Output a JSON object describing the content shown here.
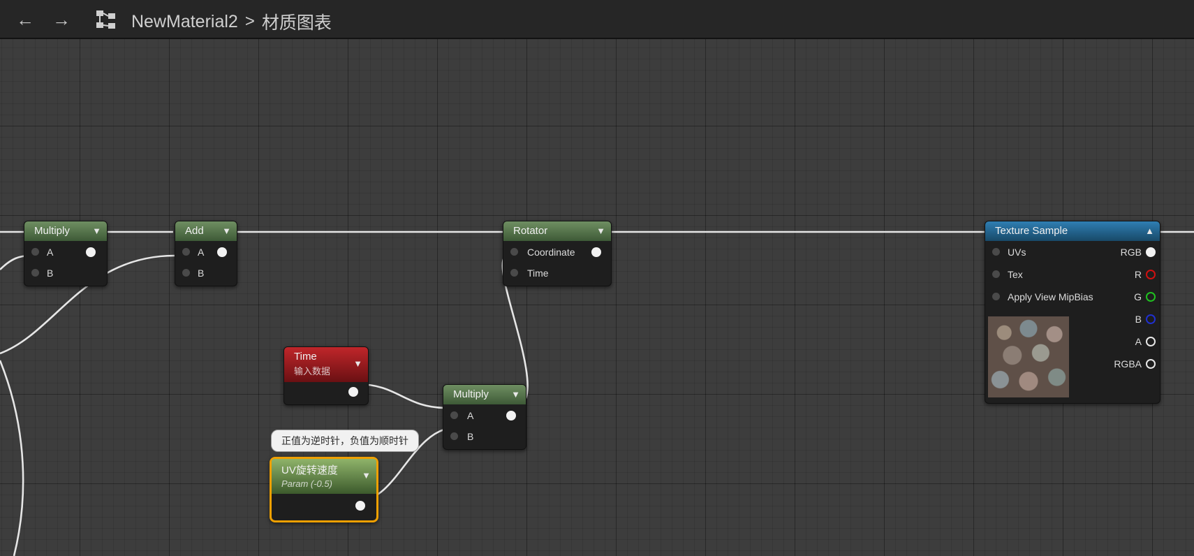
{
  "toolbar": {
    "back_icon": "arrow-left-icon",
    "forward_icon": "arrow-right-icon",
    "graph_icon": "material-graph-icon",
    "breadcrumb": {
      "asset": "NewMaterial2",
      "separator": ">",
      "page": "材质图表"
    }
  },
  "nodes": {
    "multiply1": {
      "title": "Multiply",
      "pins": {
        "a": "A",
        "b": "B"
      }
    },
    "add": {
      "title": "Add",
      "pins": {
        "a": "A",
        "b": "B"
      }
    },
    "rotator": {
      "title": "Rotator",
      "pins": {
        "coordinate": "Coordinate",
        "time": "Time"
      }
    },
    "time": {
      "title": "Time",
      "subtitle": "输入数据"
    },
    "multiply2": {
      "title": "Multiply",
      "pins": {
        "a": "A",
        "b": "B"
      }
    },
    "param": {
      "title": "UV旋转速度",
      "subtitle": "Param (-0.5)"
    },
    "texture_sample": {
      "title": "Texture Sample",
      "inputs": {
        "uvs": "UVs",
        "tex": "Tex",
        "mip": "Apply View MipBias"
      },
      "outputs": {
        "rgb": "RGB",
        "r": "R",
        "g": "G",
        "b": "B",
        "a": "A",
        "rgba": "RGBA"
      }
    }
  },
  "tooltip": "正值为逆时针，负值为顺时针",
  "colors": {
    "wire": "#e6e6e6",
    "r_pin": "#d01010",
    "g_pin": "#20c020",
    "b_pin": "#2030d0",
    "param_outline": "#f0a000"
  }
}
